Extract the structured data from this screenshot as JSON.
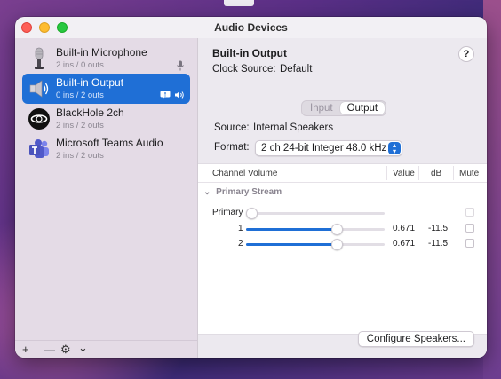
{
  "window": {
    "title": "Audio Devices"
  },
  "sidebar": {
    "devices": [
      {
        "name": "Built-in Microphone",
        "channels": "2 ins / 0 outs",
        "icon": "microphone-icon"
      },
      {
        "name": "Built-in Output",
        "channels": "0 ins / 2 outs",
        "icon": "speaker-icon",
        "selected": true
      },
      {
        "name": "BlackHole 2ch",
        "channels": "2 ins / 2 outs",
        "icon": "blackhole-icon"
      },
      {
        "name": "Microsoft Teams Audio",
        "channels": "2 ins / 2 outs",
        "icon": "teams-icon"
      }
    ],
    "footer": {
      "add": "+",
      "remove": "—",
      "gear": "⚙",
      "chevron": "⌄"
    }
  },
  "detail": {
    "title": "Built-in Output",
    "clock_source_label": "Clock Source:",
    "clock_source_value": "Default",
    "help": "?",
    "tabs": [
      "Input",
      "Output"
    ],
    "active_tab": "Output",
    "source_label": "Source:",
    "source_value": "Internal Speakers",
    "format_label": "Format:",
    "format_value": "2 ch 24-bit Integer 48.0 kHz",
    "table": {
      "headers": {
        "channel_volume": "Channel Volume",
        "value": "Value",
        "db": "dB",
        "mute": "Mute"
      },
      "group": "Primary Stream",
      "rows": [
        {
          "label": "Primary",
          "value": "",
          "db": "",
          "level": 0.0
        },
        {
          "label": "1",
          "value": "0.671",
          "db": "-11.5",
          "level": 0.671
        },
        {
          "label": "2",
          "value": "0.671",
          "db": "-11.5",
          "level": 0.671
        }
      ]
    },
    "configure_button": "Configure Speakers..."
  },
  "colors": {
    "accent": "#1f6fd6"
  }
}
